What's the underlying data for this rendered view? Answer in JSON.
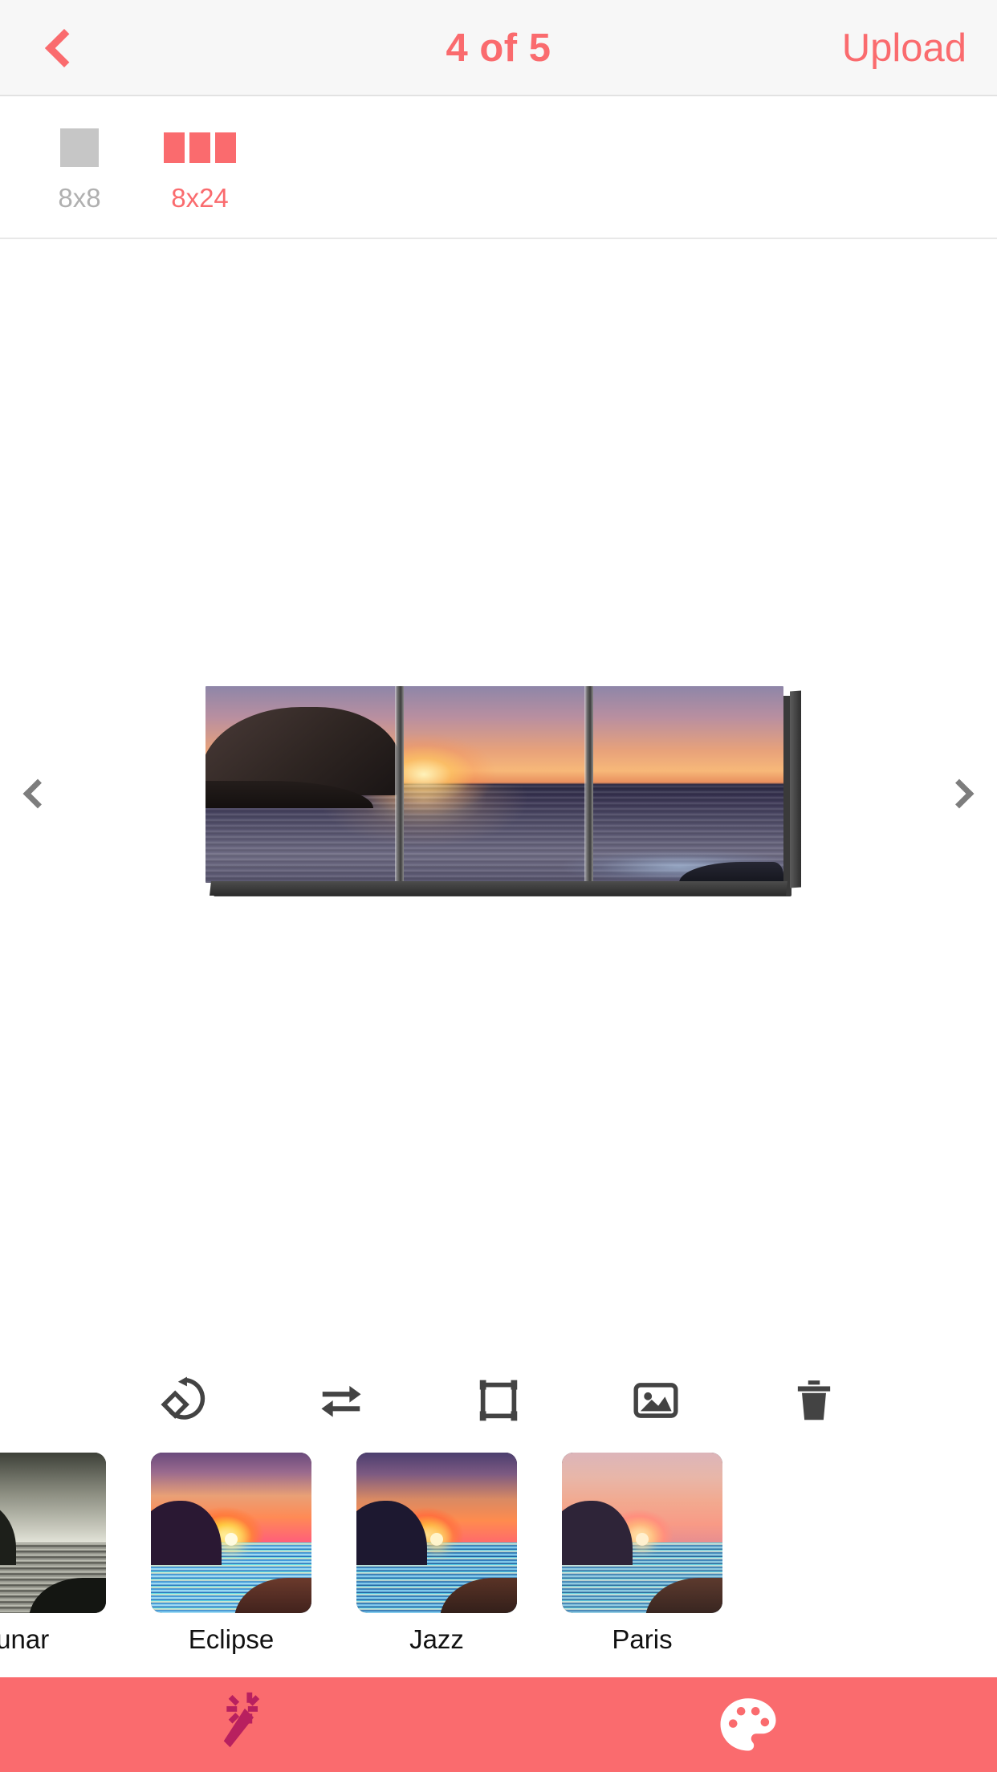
{
  "header": {
    "back_icon": "chevron-left-icon",
    "title": "4 of 5",
    "upload_label": "Upload",
    "accent_color": "#fa6b6e",
    "background_color": "#f7f7f7"
  },
  "size_selector": {
    "options": [
      {
        "label": "8x8",
        "tiles": 1,
        "selected": false,
        "color": "#c6c6c6"
      },
      {
        "label": "8x24",
        "tiles": 3,
        "selected": true,
        "color": "#fa6b6e"
      }
    ]
  },
  "stage": {
    "prev_icon": "chevron-left-icon",
    "next_icon": "chevron-right-icon",
    "preview_alt": "sunset-seascape-triptych-canvas",
    "panel_count": 3
  },
  "edit_toolbar": {
    "tools": [
      {
        "name": "rotate-icon",
        "label": "Rotate"
      },
      {
        "name": "flip-icon",
        "label": "Flip"
      },
      {
        "name": "crop-icon",
        "label": "Crop"
      },
      {
        "name": "replace-image-icon",
        "label": "Replace"
      },
      {
        "name": "delete-icon",
        "label": "Delete"
      }
    ],
    "icon_color": "#434343"
  },
  "filters": {
    "items": [
      {
        "label": "Lunar",
        "key": "f-lunar",
        "selected": false,
        "clipped": true
      },
      {
        "label": "Eclipse",
        "key": "f-eclipse",
        "selected": false,
        "clipped": false
      },
      {
        "label": "Jazz",
        "key": "f-jazz",
        "selected": false,
        "clipped": false
      },
      {
        "label": "Paris",
        "key": "f-paris",
        "selected": false,
        "clipped": false
      }
    ]
  },
  "bottom_bar": {
    "background_color": "#fa6b6e",
    "left_icon": "magic-wand-icon",
    "left_icon_color": "#b8205f",
    "right_icon": "palette-icon",
    "right_icon_color": "#ffffff"
  }
}
